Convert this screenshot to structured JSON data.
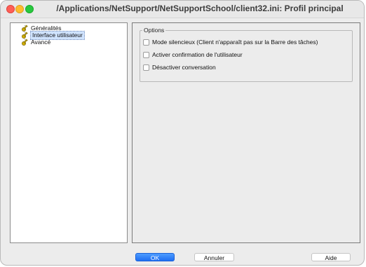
{
  "window": {
    "title": "/Applications/NetSupport/NetSupportSchool/client32.ini: Profil principal"
  },
  "tree": {
    "items": [
      {
        "label": "Généralités",
        "icon": "key-icon",
        "selected": false
      },
      {
        "label": "Interface utilisateur",
        "icon": "key-icon",
        "selected": true
      },
      {
        "label": "Avancé",
        "icon": "key-icon",
        "selected": false
      }
    ]
  },
  "options": {
    "legend": "Options",
    "checkboxes": [
      {
        "label": "Mode silencieux (Client n'apparaît pas sur la Barre des tâches)",
        "checked": false
      },
      {
        "label": "Activer confirmation de l'utilisateur",
        "checked": false
      },
      {
        "label": "Désactiver conversation",
        "checked": false
      }
    ]
  },
  "buttons": {
    "ok": "OK",
    "cancel": "Annuler",
    "help": "Aide"
  },
  "colors": {
    "accent": "#1f6ff2",
    "key_icon": "#d8b400"
  }
}
